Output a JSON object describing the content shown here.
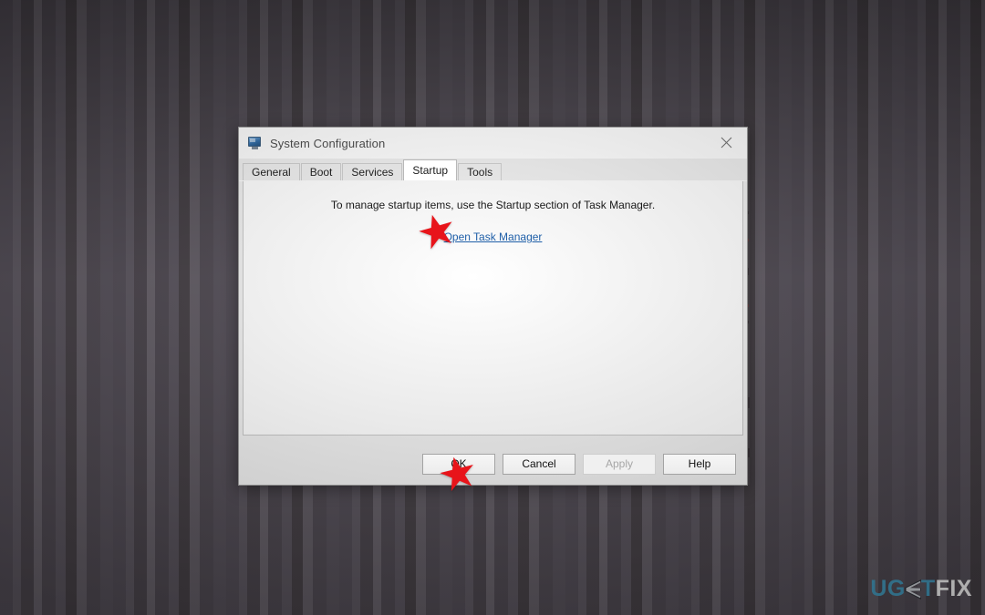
{
  "desktop": {
    "watermark": {
      "part1": "UG",
      "e_glyph": "E",
      "part2": "T",
      "part3": "FIX",
      "full_text": "UGETFIX",
      "color_accent": "#3e8fb0",
      "color_light": "#e8e8e8"
    },
    "background_color": "#585159"
  },
  "dialog": {
    "title": "System Configuration",
    "icon": "system-configuration-icon",
    "close_icon": "close-icon",
    "tabs": [
      {
        "label": "General",
        "active": false
      },
      {
        "label": "Boot",
        "active": false
      },
      {
        "label": "Services",
        "active": false
      },
      {
        "label": "Startup",
        "active": true
      },
      {
        "label": "Tools",
        "active": false
      }
    ],
    "startup_tab": {
      "note": "To manage startup items, use the Startup section of Task Manager.",
      "link_label": "Open Task Manager",
      "link_color": "#1f5fa8"
    },
    "footer_buttons": [
      {
        "label": "OK",
        "disabled": false
      },
      {
        "label": "Cancel",
        "disabled": false
      },
      {
        "label": "Apply",
        "disabled": true
      },
      {
        "label": "Help",
        "disabled": false
      }
    ]
  },
  "annotations": {
    "star_color": "#e8141a",
    "markers": [
      {
        "name": "star-marker-open-task-manager",
        "target": "Open Task Manager"
      },
      {
        "name": "star-marker-ok-button",
        "target": "OK"
      }
    ]
  }
}
